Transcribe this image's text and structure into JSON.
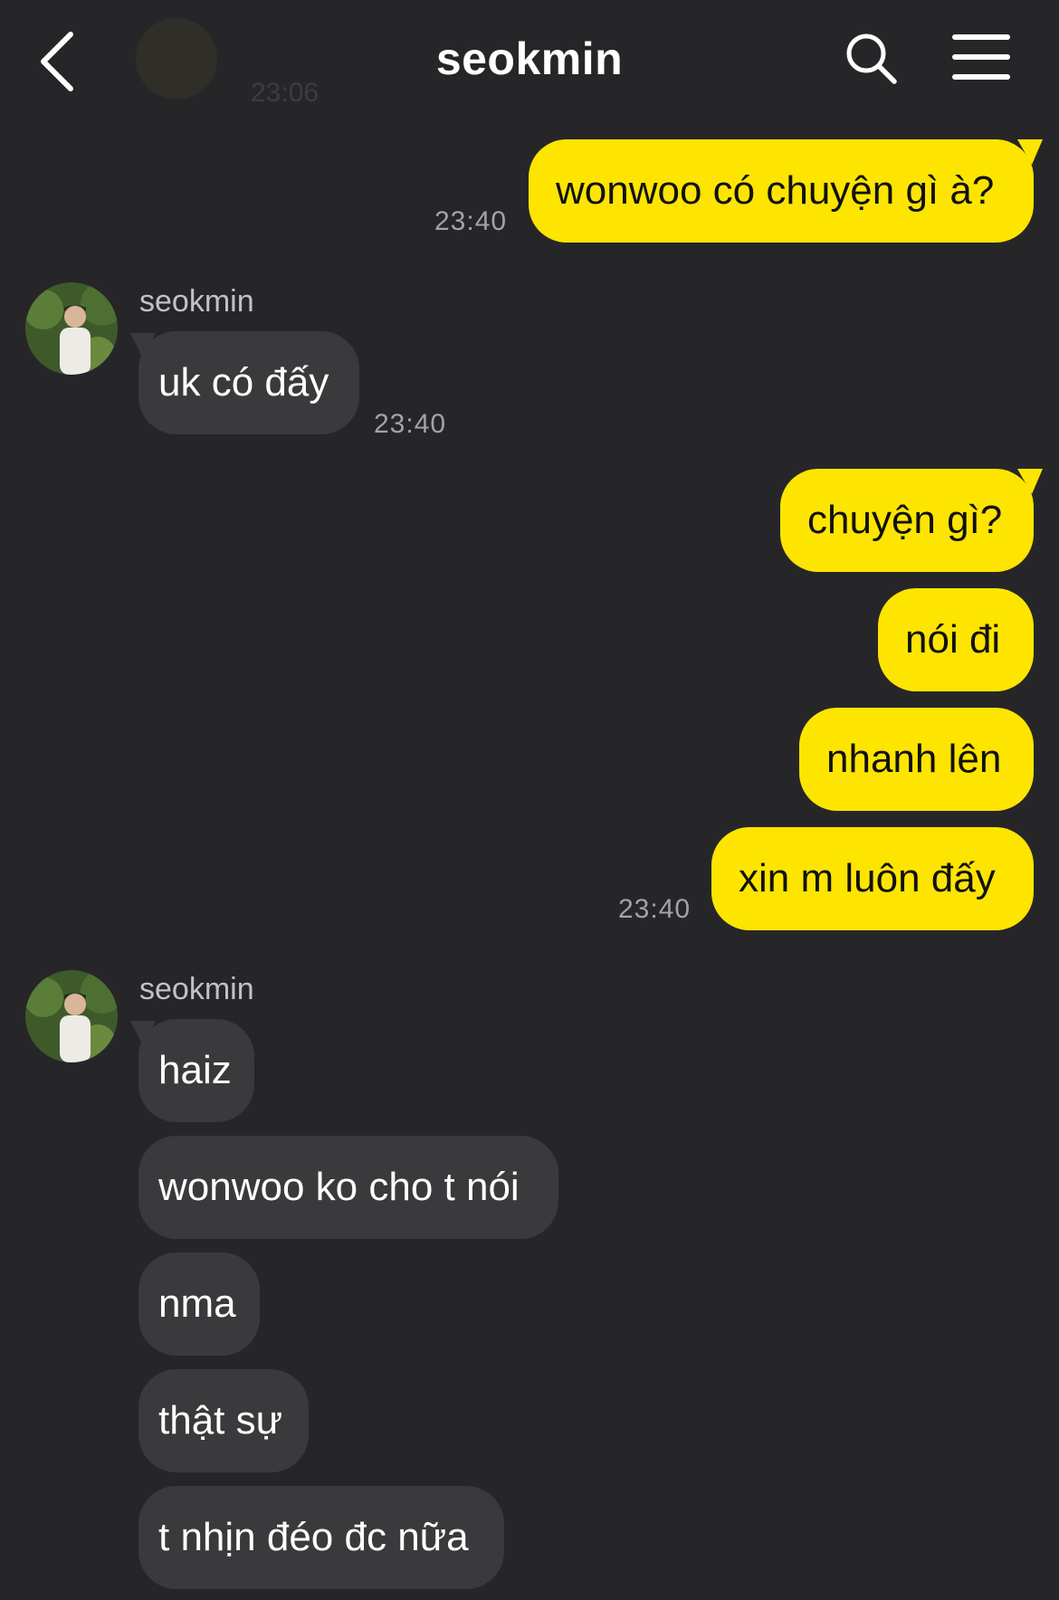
{
  "header": {
    "title": "seokmin",
    "faded_preview_time": "23:06"
  },
  "messages": {
    "out1": {
      "text": "wonwoo có chuyện gì à?",
      "time": "23:40"
    },
    "in1": {
      "sender": "seokmin",
      "text": "uk có đấy",
      "time": "23:40"
    },
    "out2": {
      "texts": [
        "chuyện gì?",
        "nói đi",
        "nhanh lên",
        "xin m luôn đấy"
      ],
      "time": "23:40"
    },
    "in2": {
      "sender": "seokmin",
      "texts": [
        "haiz",
        "wonwoo ko cho t nói",
        "nma",
        "thật sự",
        "t nhịn đéo đc nữa"
      ]
    }
  },
  "colors": {
    "background": "#262629",
    "outgoing_bubble": "#fde500",
    "incoming_bubble": "#3a3a3d",
    "timestamp": "#a3a3a7"
  },
  "icons": {
    "back": "chevron-left-icon",
    "search": "search-icon",
    "menu": "hamburger-menu-icon"
  }
}
